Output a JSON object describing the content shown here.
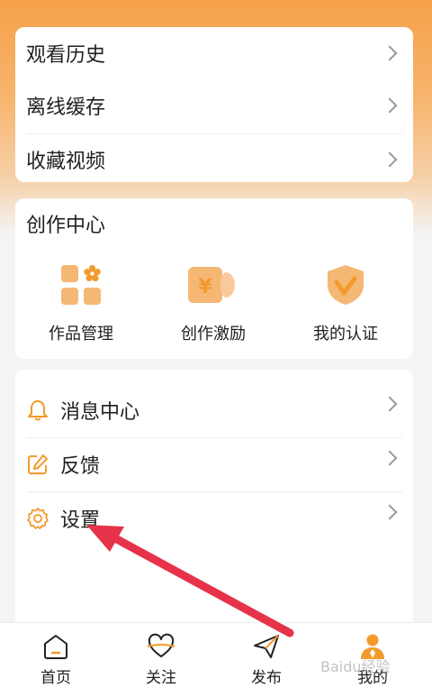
{
  "top_list": {
    "items": [
      {
        "label": "观看历史"
      },
      {
        "label": "离线缓存"
      },
      {
        "label": "收藏视频"
      }
    ]
  },
  "creator_center": {
    "title": "创作中心",
    "tools": [
      {
        "label": "作品管理",
        "icon": "works-grid-icon"
      },
      {
        "label": "创作激励",
        "icon": "yuan-reward-icon"
      },
      {
        "label": "我的认证",
        "icon": "verified-shield-icon"
      }
    ]
  },
  "settings_list": {
    "items": [
      {
        "label": "消息中心",
        "icon": "bell-icon"
      },
      {
        "label": "反馈",
        "icon": "edit-icon"
      },
      {
        "label": "设置",
        "icon": "gear-icon"
      }
    ]
  },
  "tabbar": {
    "tabs": [
      {
        "label": "首页",
        "icon": "home-icon"
      },
      {
        "label": "关注",
        "icon": "heart-icon"
      },
      {
        "label": "发布",
        "icon": "send-icon"
      },
      {
        "label": "我的",
        "icon": "person-icon",
        "active": true
      }
    ]
  },
  "watermark": "Baidu经验",
  "colors": {
    "accent": "#f39a2c",
    "arrow": "#e6334a"
  }
}
